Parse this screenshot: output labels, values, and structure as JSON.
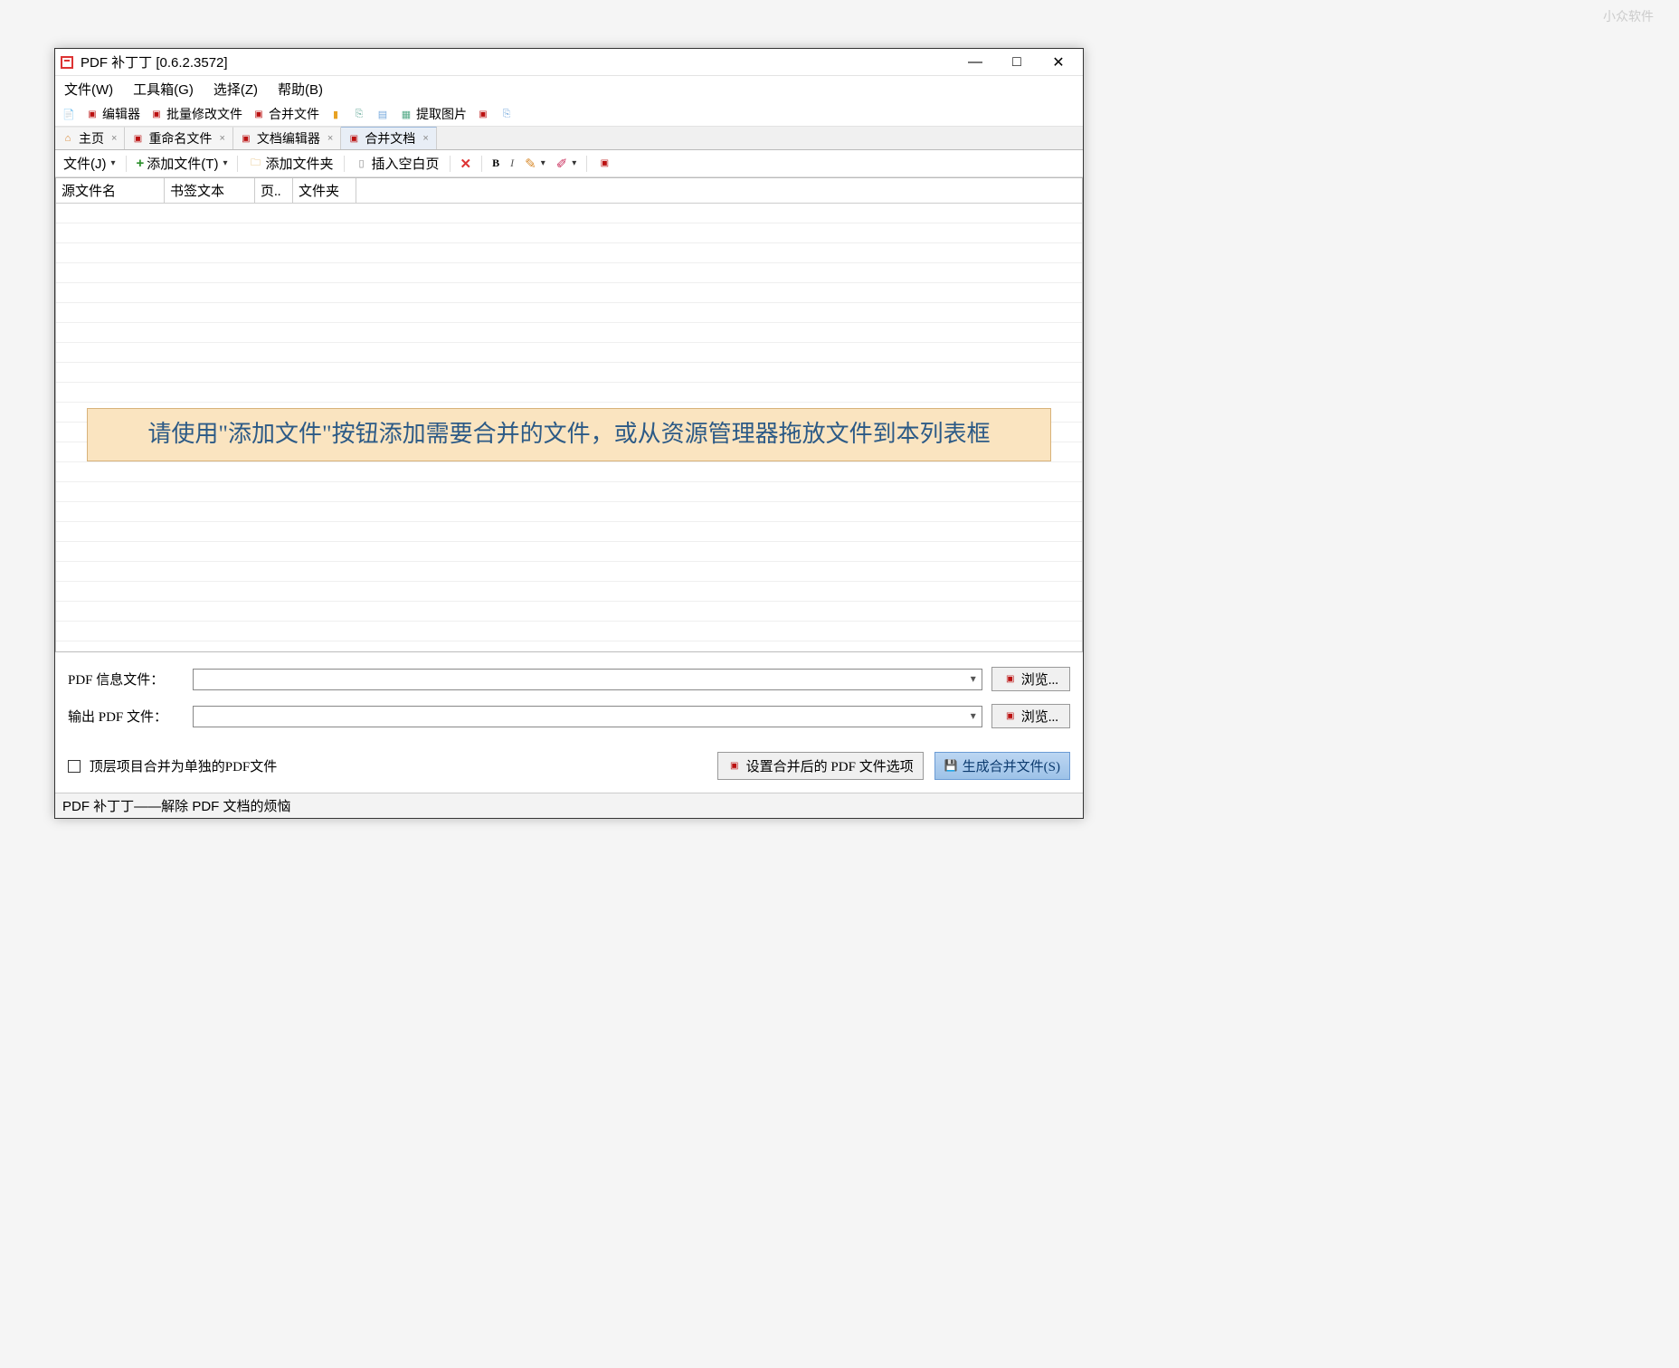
{
  "watermark": "小众软件",
  "titlebar": {
    "title": "PDF 补丁丁 [0.6.2.3572]"
  },
  "menubar": {
    "file": "文件(W)",
    "toolbox": "工具箱(G)",
    "select": "选择(Z)",
    "help": "帮助(B)"
  },
  "toolbar1": {
    "editor": "编辑器",
    "batch_modify": "批量修改文件",
    "merge_files": "合并文件",
    "extract_images": "提取图片"
  },
  "tabs": {
    "home": "主页",
    "rename": "重命名文件",
    "doc_editor": "文档编辑器",
    "merge_doc": "合并文档"
  },
  "toolbar2": {
    "file_menu": "文件(J)",
    "add_file": "添加文件(T)",
    "add_folder": "添加文件夹",
    "insert_blank": "插入空白页"
  },
  "grid": {
    "columns": {
      "source": "源文件名",
      "bookmark": "书签文本",
      "page": "页..",
      "folder": "文件夹"
    },
    "hint": "请使用\"添加文件\"按钮添加需要合并的文件，或从资源管理器拖放文件到本列表框"
  },
  "form": {
    "info_label": "PDF 信息文件：",
    "info_value": "",
    "output_label": "输出 PDF 文件：",
    "output_value": "",
    "browse": "浏览..."
  },
  "bottom": {
    "checkbox_label": "顶层项目合并为单独的PDF文件",
    "options_btn": "设置合并后的 PDF 文件选项",
    "generate_btn": "生成合并文件(S)"
  },
  "statusbar": {
    "text": "PDF 补丁丁——解除 PDF 文档的烦恼"
  }
}
